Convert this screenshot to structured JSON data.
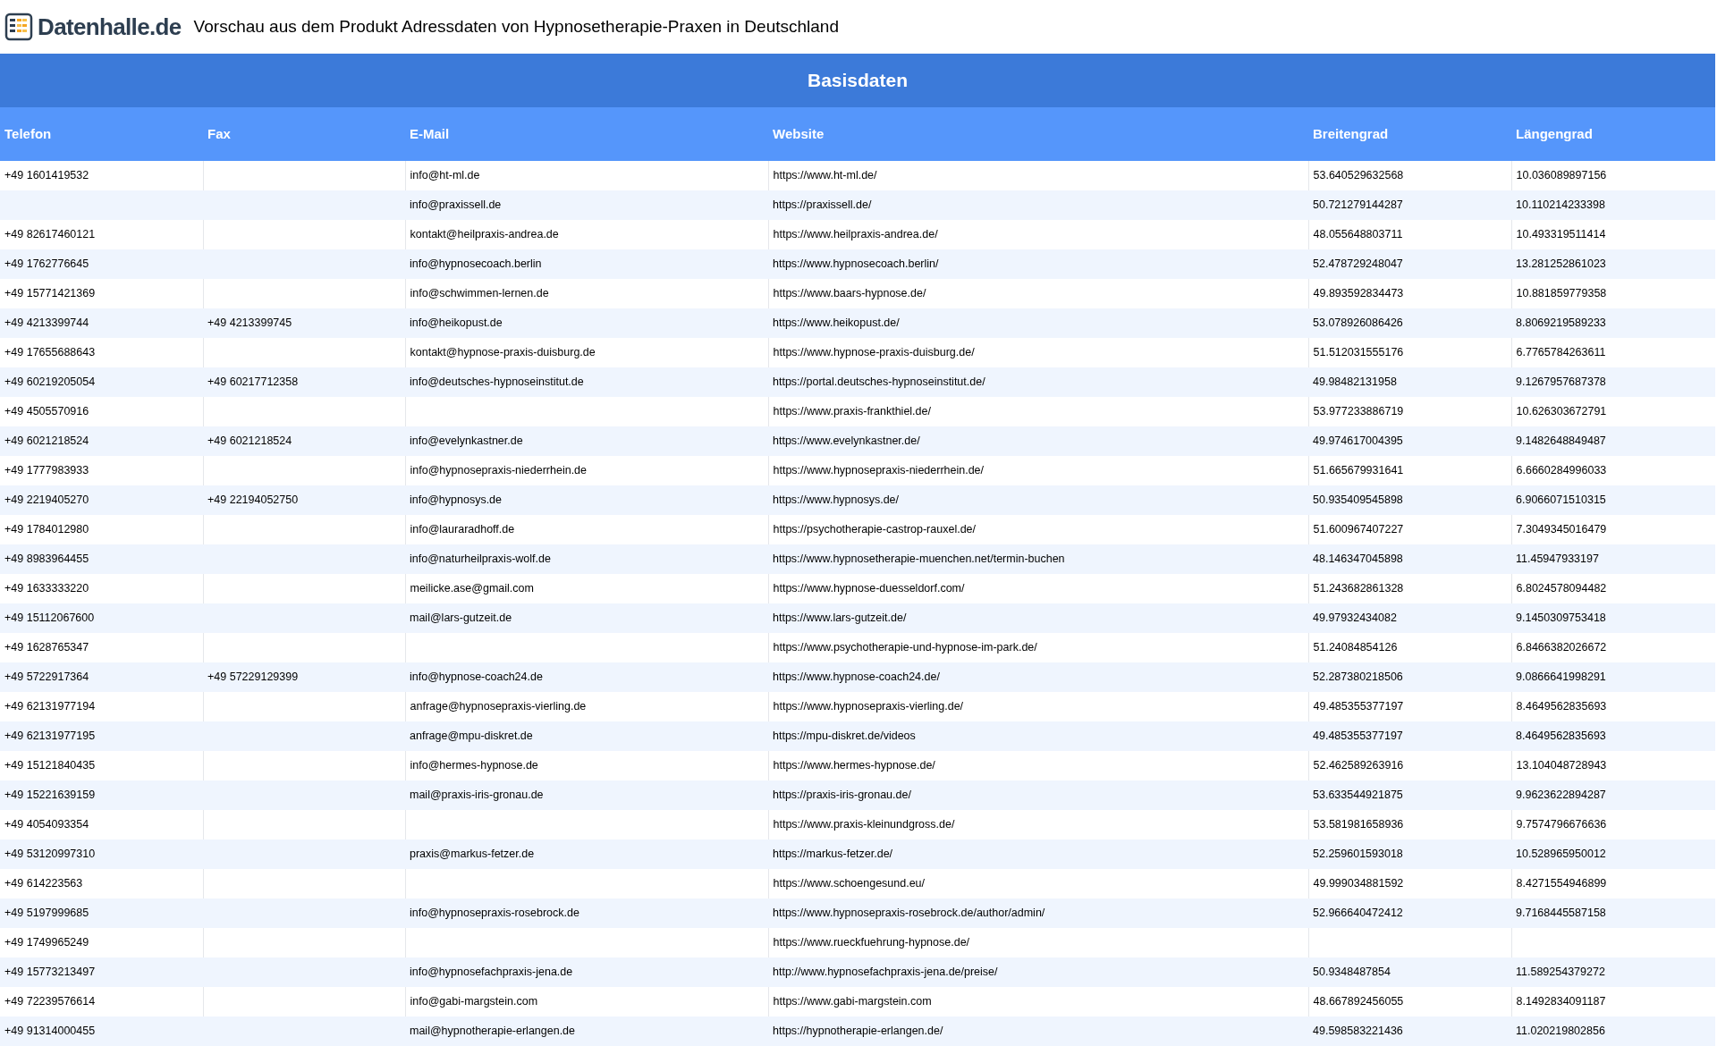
{
  "header": {
    "logo_text": "Datenhalle.de",
    "title": "Vorschau aus dem Produkt Adressdaten von Hypnosetherapie-Praxen in Deutschland"
  },
  "table": {
    "group_heading": "Basisdaten",
    "columns": [
      "Telefon",
      "Fax",
      "E-Mail",
      "Website",
      "Breitengrad",
      "Längengrad"
    ],
    "rows": [
      {
        "telefon": "+49 1601419532",
        "email": "info@ht-ml.de",
        "website": "https://www.ht-ml.de/",
        "breitengrad": "53.640529632568",
        "laengengrad": "10.036089897156"
      },
      {
        "email": "info@praxissell.de",
        "website": "https://praxissell.de/",
        "breitengrad": "50.721279144287",
        "laengengrad": "10.110214233398"
      },
      {
        "telefon": "+49 82617460121",
        "email": "kontakt@heilpraxis-andrea.de",
        "website": "https://www.heilpraxis-andrea.de/",
        "breitengrad": "48.055648803711",
        "laengengrad": "10.493319511414"
      },
      {
        "telefon": "+49 1762776645",
        "email": "info@hypnosecoach.berlin",
        "website": "https://www.hypnosecoach.berlin/",
        "breitengrad": "52.478729248047",
        "laengengrad": "13.281252861023"
      },
      {
        "telefon": "+49 15771421369",
        "email": "info@schwimmen-lernen.de",
        "website": "https://www.baars-hypnose.de/",
        "breitengrad": "49.893592834473",
        "laengengrad": "10.881859779358"
      },
      {
        "telefon": "+49 4213399744",
        "fax": "+49 4213399745",
        "email": "info@heikopust.de",
        "website": "https://www.heikopust.de/",
        "breitengrad": "53.078926086426",
        "laengengrad": "8.8069219589233"
      },
      {
        "telefon": "+49 17655688643",
        "email": "kontakt@hypnose-praxis-duisburg.de",
        "website": "https://www.hypnose-praxis-duisburg.de/",
        "breitengrad": "51.512031555176",
        "laengengrad": "6.7765784263611"
      },
      {
        "telefon": "+49 60219205054",
        "fax": "+49 60217712358",
        "email": "info@deutsches-hypnoseinstitut.de",
        "website": "https://portal.deutsches-hypnoseinstitut.de/",
        "breitengrad": "49.98482131958",
        "laengengrad": "9.1267957687378"
      },
      {
        "telefon": "+49 4505570916",
        "website": "https://www.praxis-frankthiel.de/",
        "breitengrad": "53.977233886719",
        "laengengrad": "10.626303672791"
      },
      {
        "telefon": "+49 6021218524",
        "fax": "+49 6021218524",
        "email": "info@evelynkastner.de",
        "website": "https://www.evelynkastner.de/",
        "breitengrad": "49.974617004395",
        "laengengrad": "9.1482648849487"
      },
      {
        "telefon": "+49 1777983933",
        "email": "info@hypnosepraxis-niederrhein.de",
        "website": "https://www.hypnosepraxis-niederrhein.de/",
        "breitengrad": "51.665679931641",
        "laengengrad": "6.6660284996033"
      },
      {
        "telefon": "+49 2219405270",
        "fax": "+49 22194052750",
        "email": "info@hypnosys.de",
        "website": "https://www.hypnosys.de/",
        "breitengrad": "50.935409545898",
        "laengengrad": "6.9066071510315"
      },
      {
        "telefon": "+49 1784012980",
        "email": "info@lauraradhoff.de",
        "website": "https://psychotherapie-castrop-rauxel.de/",
        "breitengrad": "51.600967407227",
        "laengengrad": "7.3049345016479"
      },
      {
        "telefon": "+49 8983964455",
        "email": "info@naturheilpraxis-wolf.de",
        "website": "https://www.hypnosetherapie-muenchen.net/termin-buchen",
        "breitengrad": "48.146347045898",
        "laengengrad": "11.45947933197"
      },
      {
        "telefon": "+49 1633333220",
        "email": "meilicke.ase@gmail.com",
        "website": "https://www.hypnose-duesseldorf.com/",
        "breitengrad": "51.243682861328",
        "laengengrad": "6.8024578094482"
      },
      {
        "telefon": "+49 15112067600",
        "email": "mail@lars-gutzeit.de",
        "website": "https://www.lars-gutzeit.de/",
        "breitengrad": "49.97932434082",
        "laengengrad": "9.1450309753418"
      },
      {
        "telefon": "+49 1628765347",
        "website": "https://www.psychotherapie-und-hypnose-im-park.de/",
        "breitengrad": "51.24084854126",
        "laengengrad": "6.8466382026672"
      },
      {
        "telefon": "+49 5722917364",
        "fax": "+49 57229129399",
        "email": "info@hypnose-coach24.de",
        "website": "https://www.hypnose-coach24.de/",
        "breitengrad": "52.287380218506",
        "laengengrad": "9.0866641998291"
      },
      {
        "telefon": "+49 62131977194",
        "email": "anfrage@hypnosepraxis-vierling.de",
        "website": "https://www.hypnosepraxis-vierling.de/",
        "breitengrad": "49.485355377197",
        "laengengrad": "8.4649562835693"
      },
      {
        "telefon": "+49 62131977195",
        "email": "anfrage@mpu-diskret.de",
        "website": "https://mpu-diskret.de/videos",
        "breitengrad": "49.485355377197",
        "laengengrad": "8.4649562835693"
      },
      {
        "telefon": "+49 15121840435",
        "email": "info@hermes-hypnose.de",
        "website": "https://www.hermes-hypnose.de/",
        "breitengrad": "52.462589263916",
        "laengengrad": "13.104048728943"
      },
      {
        "telefon": "+49 15221639159",
        "email": "mail@praxis-iris-gronau.de",
        "website": "https://praxis-iris-gronau.de/",
        "breitengrad": "53.633544921875",
        "laengengrad": "9.9623622894287"
      },
      {
        "telefon": "+49 4054093354",
        "website": "https://www.praxis-kleinundgross.de/",
        "breitengrad": "53.581981658936",
        "laengengrad": "9.7574796676636"
      },
      {
        "telefon": "+49 53120997310",
        "email": "praxis@markus-fetzer.de",
        "website": "https://markus-fetzer.de/",
        "breitengrad": "52.259601593018",
        "laengengrad": "10.528965950012"
      },
      {
        "telefon": "+49 614223563",
        "website": "https://www.schoengesund.eu/",
        "breitengrad": "49.999034881592",
        "laengengrad": "8.4271554946899"
      },
      {
        "telefon": "+49 5197999685",
        "email": "info@hypnosepraxis-rosebrock.de",
        "website": "https://www.hypnosepraxis-rosebrock.de/author/admin/",
        "breitengrad": "52.966640472412",
        "laengengrad": "9.7168445587158"
      },
      {
        "telefon": "+49 1749965249",
        "website": "https://www.rueckfuehrung-hypnose.de/"
      },
      {
        "telefon": "+49 15773213497",
        "email": "info@hypnosefachpraxis-jena.de",
        "website": "http://www.hypnosefachpraxis-jena.de/preise/",
        "breitengrad": "50.9348487854",
        "laengengrad": "11.589254379272"
      },
      {
        "telefon": "+49 72239576614",
        "email": "info@gabi-margstein.com",
        "website": "https://www.gabi-margstein.com",
        "breitengrad": "48.667892456055",
        "laengengrad": "8.1492834091187"
      },
      {
        "telefon": "+49 91314000455",
        "email": "mail@hypnotherapie-erlangen.de",
        "website": "https://hypnotherapie-erlangen.de/",
        "breitengrad": "49.598583221436",
        "laengengrad": "11.020219802856"
      }
    ]
  }
}
